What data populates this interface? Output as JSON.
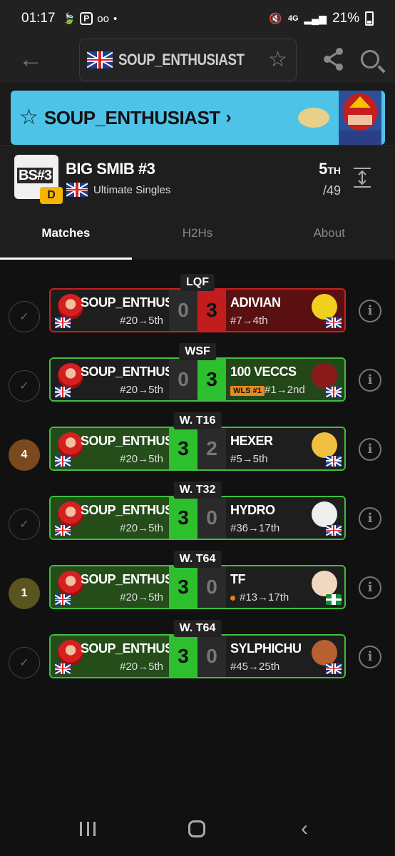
{
  "status": {
    "time": "01:17",
    "battery": "21%",
    "network": "4G"
  },
  "header": {
    "profile_name": "SOUP_ENTHUSIAST"
  },
  "banner": {
    "title": "SOUP_ENTHUSIAST",
    "chevron": "›"
  },
  "event": {
    "logo_text": "BS#3",
    "tier": "D",
    "name": "BIG SMIB #3",
    "type": "Ultimate Singles",
    "placement": "5",
    "placement_suffix": "TH",
    "entrants": "/49"
  },
  "tabs": [
    {
      "label": "Matches"
    },
    {
      "label": "H2Hs"
    },
    {
      "label": "About"
    }
  ],
  "matches": [
    {
      "round": "LQF",
      "marker": "",
      "player": "SOUP_ENTHUSI...",
      "player_seed": "#20→5th",
      "score_l": "0",
      "score_r": "3",
      "opponent": "ADIVIAN",
      "opp_seed": "#7→4th",
      "result": "loss"
    },
    {
      "round": "WSF",
      "marker": "",
      "player": "SOUP_ENTHUSI...",
      "player_seed": "#20→5th",
      "score_l": "0",
      "score_r": "3",
      "opponent": "100 VECCS",
      "opp_badge": "WLS #1",
      "opp_seed": "#1→2nd",
      "result": "loss"
    },
    {
      "round": "W. T16",
      "marker": "4",
      "player": "SOUP_ENTHUSI...",
      "player_seed": "#20→5th",
      "score_l": "3",
      "score_r": "2",
      "opponent": "HEXER",
      "opp_seed": "#5→5th",
      "result": "win"
    },
    {
      "round": "W. T32",
      "marker": "",
      "player": "SOUP_ENTHUSI...",
      "player_seed": "#20→5th",
      "score_l": "3",
      "score_r": "0",
      "opponent": "HYDRO",
      "opp_seed": "#36→17th",
      "result": "win"
    },
    {
      "round": "W. T64",
      "marker": "1",
      "player": "SOUP_ENTHUSI...",
      "player_seed": "#20→5th",
      "score_l": "3",
      "score_r": "0",
      "opponent": "TF",
      "opp_seed": "#13→17th",
      "result": "win"
    },
    {
      "round": "W. T64",
      "marker": "",
      "player": "SOUP_ENTHUSI...",
      "player_seed": "#20→5th",
      "score_l": "3",
      "score_r": "0",
      "opponent": "SYLPHICHU",
      "opp_seed": "#45→25th",
      "result": "win"
    }
  ],
  "colors": {
    "win": "#3fbf3f",
    "loss": "#c82020",
    "banner": "#4ec3e8",
    "marker4": "#7a4a1e",
    "marker1": "#5a5420"
  }
}
